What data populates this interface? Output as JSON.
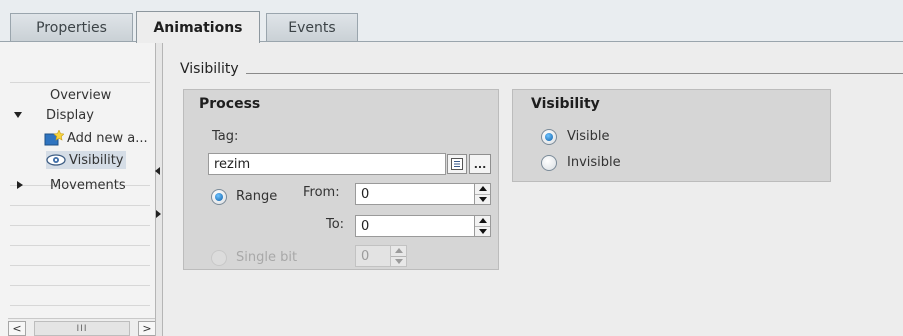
{
  "tabs": [
    {
      "label": "Properties"
    },
    {
      "label": "Animations"
    },
    {
      "label": "Events"
    }
  ],
  "nav": {
    "items": [
      {
        "label": "Overview"
      },
      {
        "label": "Display"
      },
      {
        "label": "Add new a..."
      },
      {
        "label": "Visibility"
      },
      {
        "label": "Movements"
      }
    ],
    "scroll_thumb": "III",
    "scroll_left": "<",
    "scroll_right": ">"
  },
  "section": {
    "title": "Visibility"
  },
  "process": {
    "title": "Process",
    "tag_label": "Tag:",
    "tag_value": "rezim",
    "browse_label": "...",
    "range_label": "Range",
    "from_label": "From:",
    "from_value": "0",
    "to_label": "To:",
    "to_value": "0",
    "single_bit_label": "Single bit",
    "single_bit_value": "0"
  },
  "visibility": {
    "title": "Visibility",
    "visible_label": "Visible",
    "invisible_label": "Invisible"
  },
  "icons": {
    "add": "add-animation-icon",
    "eye": "eye-icon",
    "list": "list-icon"
  }
}
